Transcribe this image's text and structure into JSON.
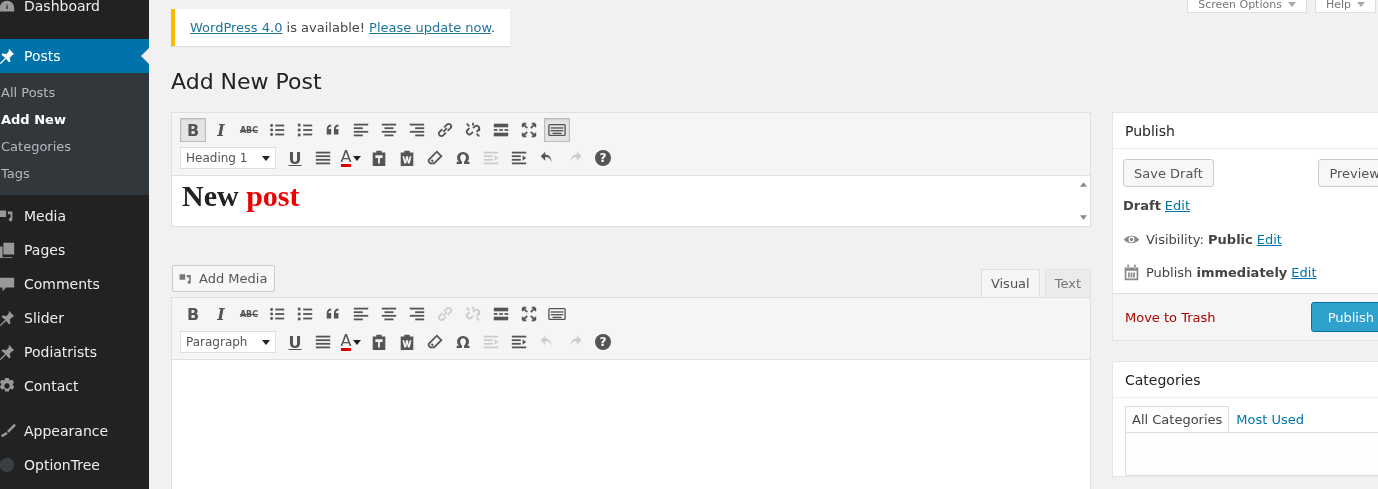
{
  "sidebar": {
    "items": [
      {
        "label": "Dashboard",
        "kind": "gauge",
        "selected": false
      },
      {
        "label": "Posts",
        "kind": "pin",
        "selected": true,
        "children": [
          {
            "label": "All Posts",
            "selected": false
          },
          {
            "label": "Add New",
            "selected": true
          },
          {
            "label": "Categories",
            "selected": false
          },
          {
            "label": "Tags",
            "selected": false
          }
        ]
      },
      {
        "label": "Media",
        "kind": "media",
        "selected": false
      },
      {
        "label": "Pages",
        "kind": "pages",
        "selected": false
      },
      {
        "label": "Comments",
        "kind": "comment",
        "selected": false
      },
      {
        "label": "Slider",
        "kind": "pin",
        "selected": false
      },
      {
        "label": "Podiatrists",
        "kind": "pin",
        "selected": false
      },
      {
        "label": "Contact",
        "kind": "gear",
        "selected": false
      },
      {
        "label": "Appearance",
        "kind": "brush",
        "selected": false
      },
      {
        "label": "OptionTree",
        "kind": "disc",
        "selected": false
      }
    ]
  },
  "top_buttons": [
    "Screen Options",
    "Help"
  ],
  "notice": {
    "link": "WordPress 4.0",
    "text": " is available! ",
    "action": "Please update now",
    "end": "."
  },
  "page_title": "Add New Post",
  "title_editor": {
    "toolbar_rows": [
      [
        {
          "kind": "bold",
          "label": "B",
          "pressed": true,
          "disabled": false
        },
        {
          "kind": "italic",
          "label": "I",
          "pressed": false,
          "disabled": false
        },
        {
          "kind": "strike",
          "label": "ABC",
          "pressed": false,
          "disabled": false
        },
        {
          "kind": "bullets",
          "pressed": false,
          "disabled": false
        },
        {
          "kind": "numbers",
          "pressed": false,
          "disabled": false
        },
        {
          "kind": "quote",
          "pressed": false,
          "disabled": false
        },
        {
          "kind": "align-left",
          "pressed": false,
          "disabled": false
        },
        {
          "kind": "align-center",
          "pressed": false,
          "disabled": false
        },
        {
          "kind": "align-right",
          "pressed": false,
          "disabled": false
        },
        {
          "kind": "link",
          "pressed": false,
          "disabled": false
        },
        {
          "kind": "unlink",
          "pressed": false,
          "disabled": false
        },
        {
          "kind": "more",
          "pressed": false,
          "disabled": false
        },
        {
          "kind": "fullscreen",
          "pressed": false,
          "disabled": false
        },
        {
          "kind": "keyboard",
          "pressed": true,
          "disabled": false
        }
      ],
      [
        {
          "kind": "format",
          "label": "Heading 1"
        },
        {
          "kind": "underline",
          "label": "U",
          "pressed": false,
          "disabled": false
        },
        {
          "kind": "justify",
          "pressed": false,
          "disabled": false
        },
        {
          "kind": "text-color",
          "label": "A",
          "pressed": false,
          "disabled": false
        },
        {
          "kind": "paste-text",
          "pressed": false,
          "disabled": false
        },
        {
          "kind": "paste-word",
          "pressed": false,
          "disabled": false
        },
        {
          "kind": "eraser",
          "pressed": false,
          "disabled": false
        },
        {
          "kind": "omega",
          "label": "Ω",
          "pressed": false,
          "disabled": false
        },
        {
          "kind": "outdent",
          "pressed": false,
          "disabled": true
        },
        {
          "kind": "indent",
          "pressed": false,
          "disabled": false
        },
        {
          "kind": "undo",
          "pressed": false,
          "disabled": false
        },
        {
          "kind": "redo",
          "pressed": false,
          "disabled": true
        },
        {
          "kind": "help",
          "label": "?",
          "pressed": false,
          "disabled": false
        }
      ]
    ],
    "content": [
      {
        "text": "New ",
        "color": "#222222"
      },
      {
        "text": "post",
        "color": "#ee0000"
      }
    ]
  },
  "add_media": "Add Media",
  "editor_tabs": [
    {
      "label": "Visual",
      "selected": true
    },
    {
      "label": "Text",
      "selected": false
    }
  ],
  "body_editor": {
    "toolbar_rows": [
      [
        {
          "kind": "bold",
          "label": "B",
          "pressed": false,
          "disabled": false
        },
        {
          "kind": "italic",
          "label": "I",
          "pressed": false,
          "disabled": false
        },
        {
          "kind": "strike",
          "label": "ABC",
          "pressed": false,
          "disabled": false
        },
        {
          "kind": "bullets",
          "pressed": false,
          "disabled": false
        },
        {
          "kind": "numbers",
          "pressed": false,
          "disabled": false
        },
        {
          "kind": "quote",
          "pressed": false,
          "disabled": false
        },
        {
          "kind": "align-left",
          "pressed": false,
          "disabled": false
        },
        {
          "kind": "align-center",
          "pressed": false,
          "disabled": false
        },
        {
          "kind": "align-right",
          "pressed": false,
          "disabled": false
        },
        {
          "kind": "link",
          "pressed": false,
          "disabled": true
        },
        {
          "kind": "unlink",
          "pressed": false,
          "disabled": true
        },
        {
          "kind": "more",
          "pressed": false,
          "disabled": false
        },
        {
          "kind": "fullscreen",
          "pressed": false,
          "disabled": false
        },
        {
          "kind": "keyboard",
          "pressed": false,
          "disabled": false
        }
      ],
      [
        {
          "kind": "format",
          "label": "Paragraph"
        },
        {
          "kind": "underline",
          "label": "U",
          "pressed": false,
          "disabled": false
        },
        {
          "kind": "justify",
          "pressed": false,
          "disabled": false
        },
        {
          "kind": "text-color",
          "label": "A",
          "pressed": false,
          "disabled": false
        },
        {
          "kind": "paste-text",
          "pressed": false,
          "disabled": false
        },
        {
          "kind": "paste-word",
          "pressed": false,
          "disabled": false
        },
        {
          "kind": "eraser",
          "pressed": false,
          "disabled": false
        },
        {
          "kind": "omega",
          "label": "Ω",
          "pressed": false,
          "disabled": false
        },
        {
          "kind": "outdent",
          "pressed": false,
          "disabled": true
        },
        {
          "kind": "indent",
          "pressed": false,
          "disabled": false
        },
        {
          "kind": "undo",
          "pressed": false,
          "disabled": true
        },
        {
          "kind": "redo",
          "pressed": false,
          "disabled": true
        },
        {
          "kind": "help",
          "label": "?",
          "pressed": false,
          "disabled": false
        }
      ]
    ]
  },
  "publish_box": {
    "title": "Publish",
    "save_draft": "Save Draft",
    "preview": "Preview",
    "status": {
      "value": "Draft",
      "link": "Edit"
    },
    "visibility": {
      "text": "Visibility: **Public**",
      "link": "Edit"
    },
    "schedule": {
      "text": "Publish **immediately**",
      "link": "Edit"
    },
    "trash": "Move to Trash",
    "publish": "Publish"
  },
  "categories_box": {
    "title": "Categories",
    "tabs": [
      {
        "label": "All Categories",
        "selected": true
      },
      {
        "label": "Most Used",
        "selected": false
      }
    ]
  }
}
